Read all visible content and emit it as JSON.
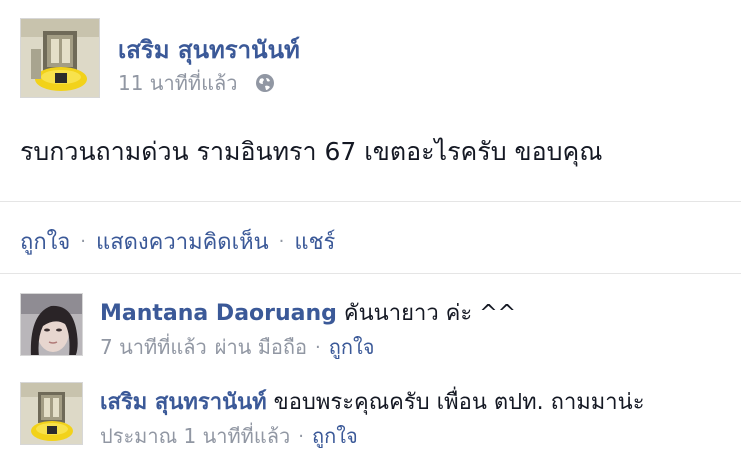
{
  "post": {
    "author": "เสริม สุนทรานันท์",
    "timestamp": "11 นาทีที่แล้ว",
    "privacy_icon": "globe-icon",
    "body": "รบกวนถามด่วน รามอินทรา 67 เขตอะไรครับ ขอบคุณ"
  },
  "actions": {
    "like": "ถูกใจ",
    "comment": "แสดงความคิดเห็น",
    "share": "แชร์"
  },
  "comments": [
    {
      "author": "Mantana Daoruang",
      "text": "คันนายาว ค่ะ ^^",
      "timestamp": "7 นาทีที่แล้ว",
      "via": "ผ่าน มือถือ",
      "like": "ถูกใจ"
    },
    {
      "author": "เสริม สุนทรานันท์",
      "text": "ขอบพระคุณครับ เพื่อน ตปท. ถามมาน่ะ",
      "timestamp": "ประมาณ 1 นาทีที่แล้ว",
      "like": "ถูกใจ"
    }
  ],
  "colors": {
    "link": "#3b5998",
    "muted": "#9197a3",
    "text": "#141823"
  }
}
